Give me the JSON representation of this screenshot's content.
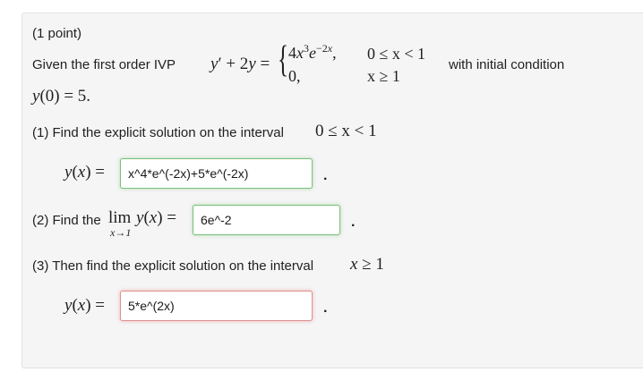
{
  "problem": {
    "points": "(1 point)",
    "intro_text": "Given the first order IVP",
    "ivp_lhs": "y′ + 2y =",
    "piece1_expr": "4x³e^(−2x),",
    "piece1_cond": "0 ≤ x < 1",
    "piece2_expr": "0,",
    "piece2_cond": "x ≥ 1",
    "with_condition": "with initial condition",
    "initial_condition": "y(0) = 5."
  },
  "parts": [
    {
      "prompt": "(1) Find the explicit solution on the interval",
      "interval": "0 ≤ x < 1",
      "answer_label": "y(x) =",
      "answer_value": "x^4*e^(-2x)+5*e^(-2x)",
      "status": "correct",
      "trailing": "."
    },
    {
      "prompt": "(2) Find the",
      "lim_word": "lim",
      "lim_sub": "x→1",
      "lim_arg": "y(x) =",
      "answer_value": "6e^-2",
      "status": "correct",
      "trailing": "."
    },
    {
      "prompt": "(3) Then find the explicit solution on the interval",
      "interval": "x ≥ 1",
      "answer_label": "y(x) =",
      "answer_value": "5*e^(2x)",
      "status": "incorrect",
      "trailing": "."
    }
  ]
}
